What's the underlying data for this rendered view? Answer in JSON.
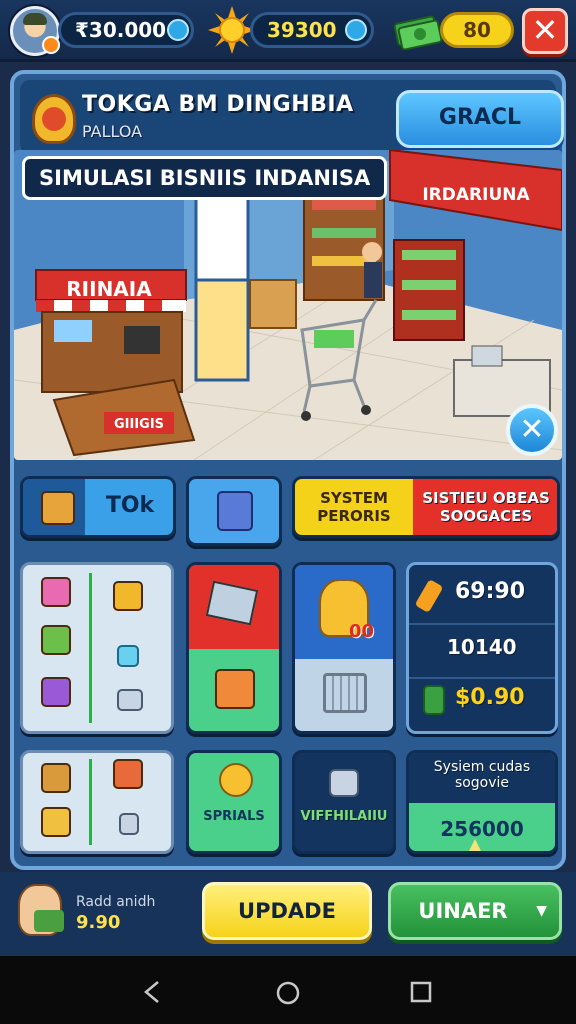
{
  "hud": {
    "coins": "₹30.000",
    "energy": "39300",
    "cash": "80",
    "close_label": "✕"
  },
  "panel": {
    "title": "TOKGA BM DINGHBIA",
    "subtitle": "PALLOA",
    "action_button": "GRACL",
    "banner": "SIMULASI BISNIIS INDANISA",
    "shop_sign_left": "RIINAIA",
    "shop_sign_right": "IRDARIUNA",
    "counter_sign": "GIIIGIS"
  },
  "tabs": {
    "tok_label": "TOk",
    "system_yellow": "SYSTEM PERORIS",
    "system_red": "SISTIEU OBEAS SOOGACES"
  },
  "stats": {
    "price_1": "69:90",
    "price_2": "10140",
    "price_3": "$0.90",
    "crate_badge": "00"
  },
  "row3": {
    "green_label": "SPRIALS",
    "dark_label": "VIFFHILAIIU",
    "info_title": "Sysiem cudas sogovie",
    "info_value": "256000"
  },
  "footer": {
    "player_line1": "Radd anidh",
    "player_value": "9.90",
    "update_button": "UPDADE",
    "uinaer_button": "UINAER",
    "uinaer_icon": "chevron-down-icon"
  },
  "navigation": {
    "back_icon": "back-triangle-icon",
    "home_icon": "home-circle-icon",
    "recents_icon": "recents-square-icon"
  }
}
